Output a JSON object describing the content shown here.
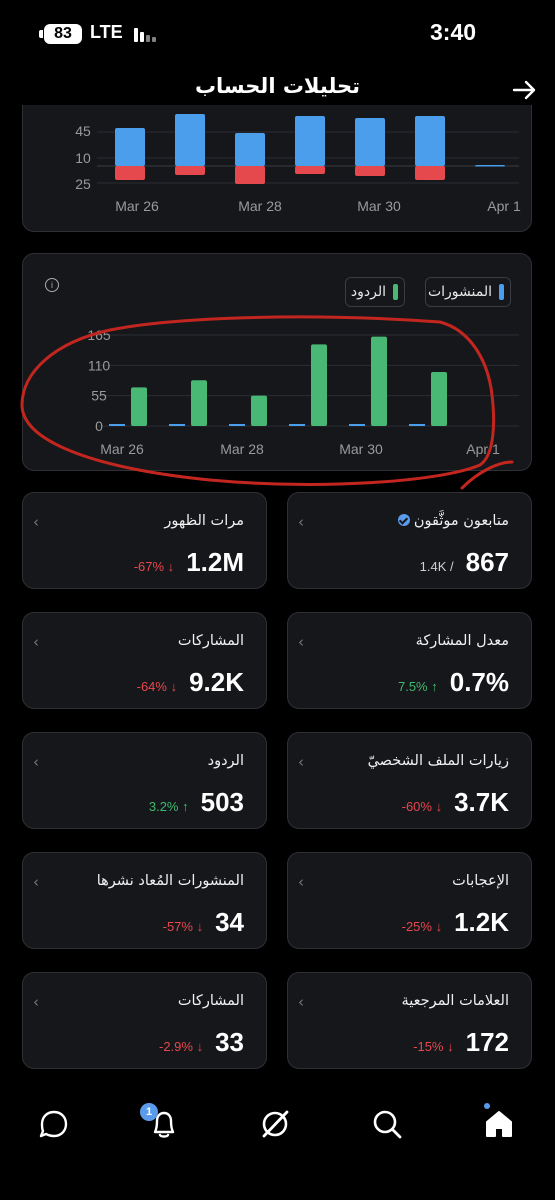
{
  "status_bar": {
    "battery": "83",
    "network": "LTE",
    "time": "3:40"
  },
  "header": {
    "title": "تحليلات الحساب"
  },
  "chart_data": [
    {
      "type": "bar",
      "x": [
        "Mar 26",
        "Mar 27",
        "Mar 28",
        "Mar 29",
        "Mar 30",
        "Mar 31",
        "Apr 1"
      ],
      "tick_labels_x": [
        "Mar 26",
        "Mar 28",
        "Mar 30",
        "Apr 1"
      ],
      "tick_labels_y": [
        "45",
        "10",
        "25"
      ],
      "series": [
        {
          "values_above": [
            38,
            52,
            33,
            50,
            48,
            50,
            1
          ],
          "color": "#4a9eec"
        },
        {
          "values_below": [
            14,
            9,
            18,
            8,
            10,
            14,
            0
          ],
          "color": "#e5484d"
        }
      ],
      "grid": true
    },
    {
      "type": "bar",
      "x": [
        "Mar 26",
        "Mar 27",
        "Mar 28",
        "Mar 29",
        "Mar 30",
        "Mar 31",
        "Apr 1"
      ],
      "tick_labels_x": [
        "Mar 26",
        "Mar 28",
        "Mar 30",
        "Apr 1"
      ],
      "tick_labels_y": [
        "165",
        "110",
        "55",
        "0"
      ],
      "ylim": [
        0,
        165
      ],
      "legend_placement": "top-right",
      "series": [
        {
          "name": "المنشورات",
          "values": [
            1,
            1,
            2,
            2,
            1,
            1,
            0
          ],
          "color": "#4a9eec"
        },
        {
          "name": "الردود",
          "values": [
            70,
            83,
            55,
            148,
            162,
            98,
            0
          ],
          "color": "#48b874"
        }
      ],
      "grid": true
    }
  ],
  "metrics": [
    {
      "title": "متابعون موثَّقون",
      "value": "867",
      "change": "1.4K /",
      "change_color": "gray",
      "verified": true
    },
    {
      "title": "مرات الظهور",
      "value": "1.2M",
      "change": "-67% ↓",
      "change_color": "red"
    },
    {
      "title": "معدل المشاركة",
      "value": "0.7%",
      "change": "7.5% ↑",
      "change_color": "green"
    },
    {
      "title": "المشاركات",
      "value": "9.2K",
      "change": "-64% ↓",
      "change_color": "red"
    },
    {
      "title": "زيارات الملف الشخصيّ",
      "value": "3.7K",
      "change": "-60% ↓",
      "change_color": "red"
    },
    {
      "title": "الردود",
      "value": "503",
      "change": "3.2% ↑",
      "change_color": "green"
    },
    {
      "title": "الإعجابات",
      "value": "1.2K",
      "change": "-25% ↓",
      "change_color": "red"
    },
    {
      "title": "المنشورات المُعاد نشرها",
      "value": "34",
      "change": "-57% ↓",
      "change_color": "red"
    },
    {
      "title": "العلامات المرجعية",
      "value": "172",
      "change": "-15% ↓",
      "change_color": "red"
    },
    {
      "title": "المشاركات",
      "value": "33",
      "change": "-2.9% ↓",
      "change_color": "red"
    }
  ],
  "nav": {
    "items": [
      "home-icon",
      "search-icon",
      "grok-icon",
      "notifications-icon",
      "messages-icon"
    ],
    "notification_count": "1",
    "accent": "#5b9bec"
  },
  "colors": {
    "annotation": "#c3261f"
  }
}
